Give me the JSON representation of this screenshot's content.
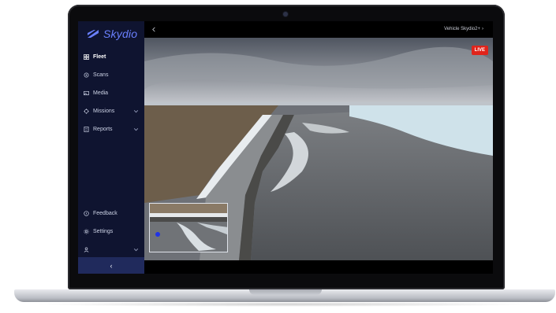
{
  "brand": {
    "name": "Skydio",
    "color": "#6a80ff"
  },
  "sidebar": {
    "items": [
      {
        "label": "Fleet",
        "icon": "fleet-icon",
        "active": true
      },
      {
        "label": "Scans",
        "icon": "scans-icon"
      },
      {
        "label": "Media",
        "icon": "media-icon"
      },
      {
        "label": "Missions",
        "icon": "missions-icon",
        "expandable": true
      },
      {
        "label": "Reports",
        "icon": "reports-icon",
        "expandable": true
      }
    ],
    "bottom_items": [
      {
        "label": "Feedback",
        "icon": "feedback-icon"
      },
      {
        "label": "Settings",
        "icon": "settings-icon"
      },
      {
        "label": "",
        "icon": "user-icon",
        "expandable": true
      }
    ],
    "collapse_label": "‹"
  },
  "topbar": {
    "back_icon": "back-arrow-icon",
    "vehicle_label": "Vehicle Skydio2+",
    "vehicle_chevron": "›"
  },
  "video": {
    "live_label": "LIVE",
    "live_color": "#e0241b",
    "minimap_marker_color": "#2033e6"
  }
}
